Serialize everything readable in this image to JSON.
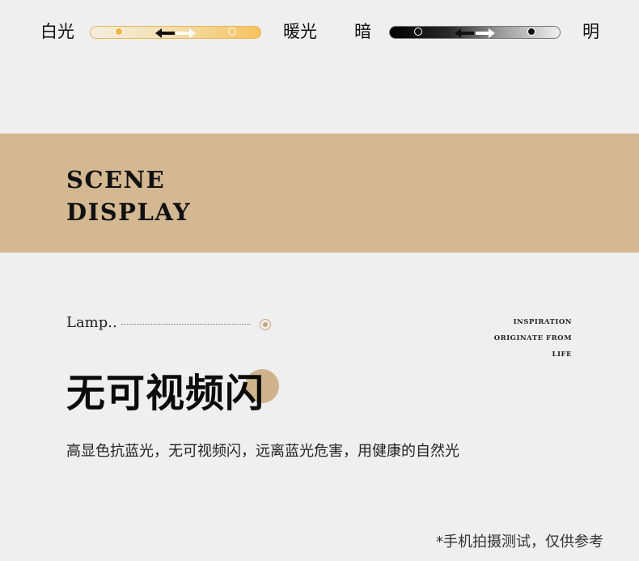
{
  "sliders": {
    "warm_label_left": "白光",
    "warm_label_right": "暖光",
    "dark_label_left": "暗",
    "dark_label_right": "明"
  },
  "banner": {
    "line1": "SCENE",
    "line2": "DISPLAY"
  },
  "section": {
    "lamp_label": "Lamp..",
    "inspiration": [
      "INSPIRATION",
      "ORIGINATE FROM",
      "LIFE"
    ],
    "headline": "无可视频闪",
    "subtitle": "高显色抗蓝光，无可视频闪，远离蓝光危害，用健康的自然光",
    "note": "*手机拍摄测试，仅供参考"
  },
  "colors": {
    "background": "#efefef",
    "banner": "#d4b892",
    "accent_circle": "#cfb38d",
    "warm_knob": "#f2b33d"
  }
}
